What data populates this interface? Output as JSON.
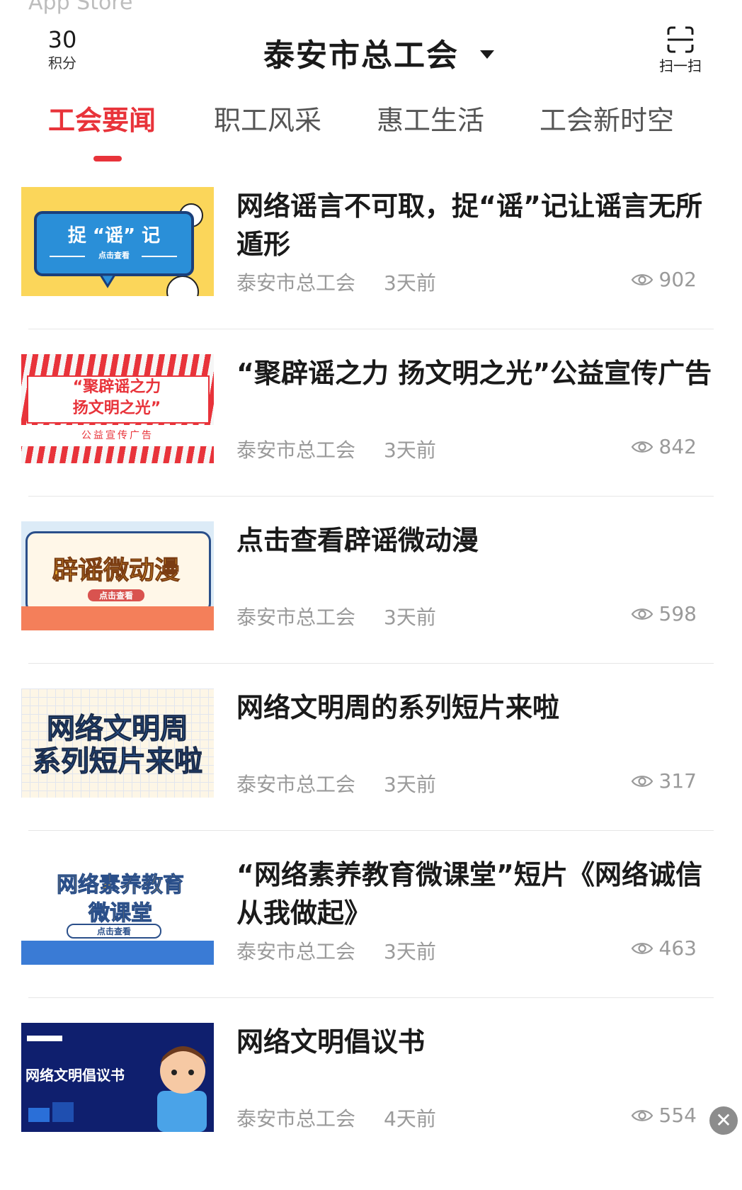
{
  "status_bar": {
    "back_app": "App Store"
  },
  "header": {
    "points_value": "30",
    "points_label": "积分",
    "title": "泰安市总工会",
    "scan_label": "扫一扫"
  },
  "tabs": [
    {
      "label": "工会要闻",
      "active": true
    },
    {
      "label": "职工风采",
      "active": false
    },
    {
      "label": "惠工生活",
      "active": false
    },
    {
      "label": "工会新时空",
      "active": false
    }
  ],
  "articles": [
    {
      "title": "网络谣言不可取，捉“谣”记让谣言无所遁形",
      "source": "泰安市总工会",
      "time": "3天前",
      "views": "902",
      "thumb": {
        "line1": "捉 “谣” 记",
        "line2": "点击查看"
      }
    },
    {
      "title": "“聚辟谣之力 扬文明之光”公益宣传广告",
      "source": "泰安市总工会",
      "time": "3天前",
      "views": "842",
      "thumb": {
        "line1": "“聚辟谣之力",
        "line2": "扬文明之光”",
        "line3": "公益宣传广告"
      }
    },
    {
      "title": "点击查看辟谣微动漫",
      "source": "泰安市总工会",
      "time": "3天前",
      "views": "598",
      "thumb": {
        "line1": "辟谣微动漫",
        "line2": "点击查看"
      }
    },
    {
      "title": "网络文明周的系列短片来啦",
      "source": "泰安市总工会",
      "time": "3天前",
      "views": "317",
      "thumb": {
        "line1": "网络文明周",
        "line2": "系列短片来啦"
      }
    },
    {
      "title": "“网络素养教育微课堂”短片《网络诚信从我做起》",
      "source": "泰安市总工会",
      "time": "3天前",
      "views": "463",
      "thumb": {
        "line1": "网络素养教育",
        "line2": "微课堂",
        "line3": "点击查看"
      }
    },
    {
      "title": "网络文明倡议书",
      "source": "泰安市总工会",
      "time": "4天前",
      "views": "554",
      "thumb": {
        "line1": "网络文明倡议书"
      }
    }
  ],
  "colors": {
    "accent": "#e8333a",
    "muted": "#9a9a9a"
  }
}
